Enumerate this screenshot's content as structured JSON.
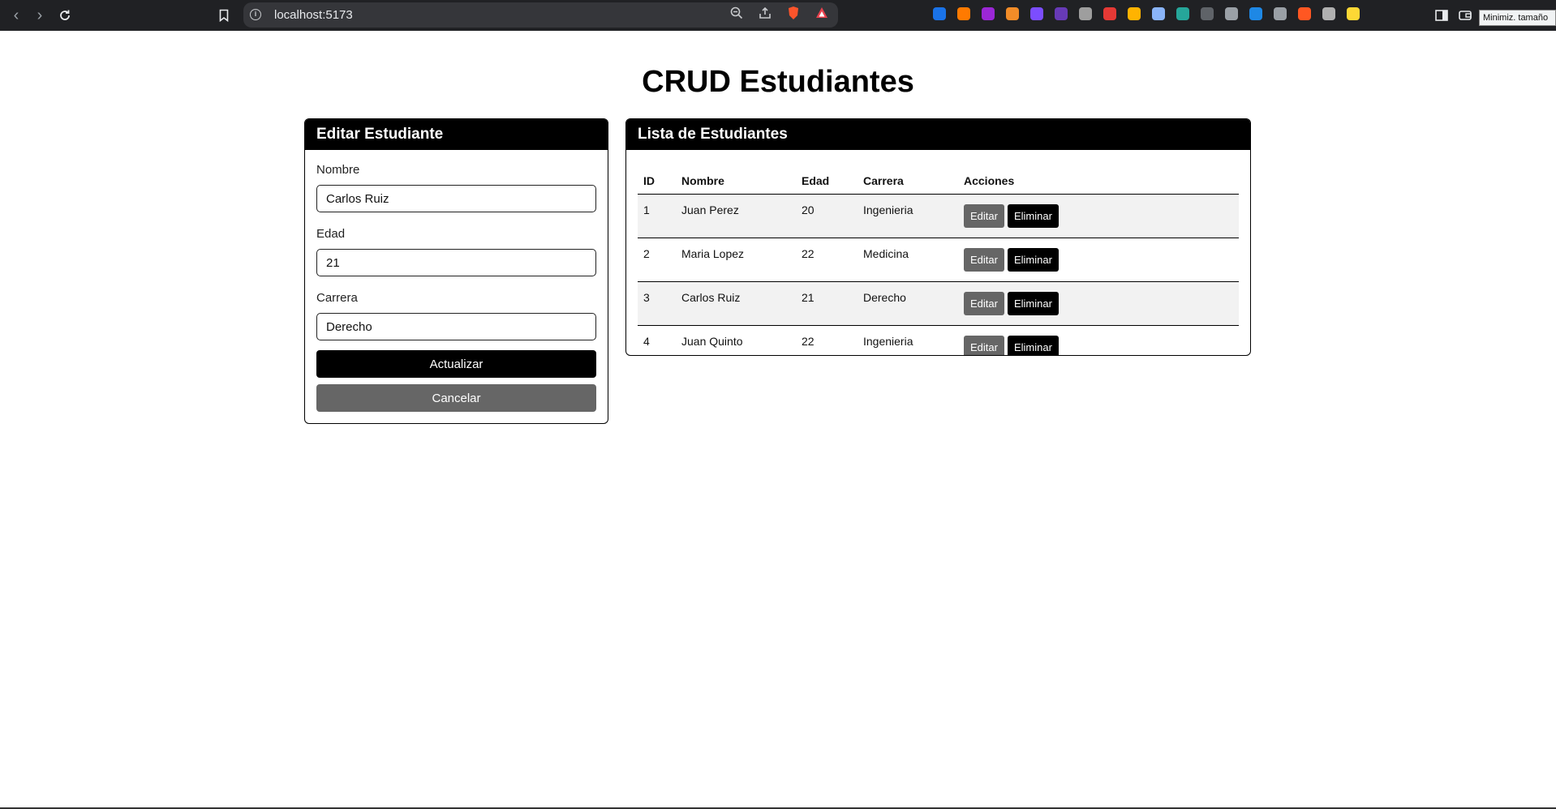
{
  "browser": {
    "url": "localhost:5173",
    "tooltip": "Minimiz. tamaño",
    "colors": {
      "chrome_bg": "#202124",
      "urlbar_bg": "#35363a"
    },
    "extensions": [
      {
        "icon": "ext-fi-icon",
        "color": "#1a73e8"
      },
      {
        "icon": "ext-orange-icon",
        "color": "#ff7a00"
      },
      {
        "icon": "ext-purple-circle-icon",
        "color": "#9b27d6"
      },
      {
        "icon": "ext-fox-icon",
        "color": "#f28c28"
      },
      {
        "icon": "ext-purple-square-icon",
        "color": "#7c4dff"
      },
      {
        "icon": "ext-badge-icon",
        "color": "#673ab7"
      },
      {
        "icon": "ext-pin-icon",
        "color": "#9e9e9e"
      },
      {
        "icon": "ext-red-icon",
        "color": "#e53935"
      },
      {
        "icon": "ext-yellow-circle-icon",
        "color": "#ffb300"
      },
      {
        "icon": "ext-doc-icon",
        "color": "#8ab4f8"
      },
      {
        "icon": "ext-teal-icon",
        "color": "#26a69a"
      },
      {
        "icon": "ext-puzzle-dark-icon",
        "color": "#5f6368"
      },
      {
        "icon": "ext-camera-icon",
        "color": "#9aa0a6"
      },
      {
        "icon": "ext-check-icon",
        "color": "#1e88e5"
      },
      {
        "icon": "ext-window-icon",
        "color": "#9aa0a6"
      },
      {
        "icon": "ext-flame-icon",
        "color": "#ff5722"
      },
      {
        "icon": "ext-pen-icon",
        "color": "#b0b0b0"
      },
      {
        "icon": "ext-yellow-icon",
        "color": "#fdd835"
      }
    ]
  },
  "page": {
    "title": "CRUD Estudiantes"
  },
  "form": {
    "header": "Editar Estudiante",
    "nombre_label": "Nombre",
    "nombre_value": "Carlos Ruiz",
    "edad_label": "Edad",
    "edad_value": "21",
    "carrera_label": "Carrera",
    "carrera_value": "Derecho",
    "update_label": "Actualizar",
    "cancel_label": "Cancelar"
  },
  "list": {
    "header": "Lista de Estudiantes",
    "columns": [
      "ID",
      "Nombre",
      "Edad",
      "Carrera",
      "Acciones"
    ],
    "rows": [
      {
        "id": "1",
        "nombre": "Juan Perez",
        "edad": "20",
        "carrera": "Ingenieria"
      },
      {
        "id": "2",
        "nombre": "Maria Lopez",
        "edad": "22",
        "carrera": "Medicina"
      },
      {
        "id": "3",
        "nombre": "Carlos Ruiz",
        "edad": "21",
        "carrera": "Derecho"
      },
      {
        "id": "4",
        "nombre": "Juan Quinto",
        "edad": "22",
        "carrera": "Ingenieria"
      }
    ],
    "edit_label": "Editar",
    "delete_label": "Eliminar"
  },
  "theme": {
    "accent": "#000000",
    "secondary": "#666666",
    "row_stripe": "#f2f2f2"
  }
}
